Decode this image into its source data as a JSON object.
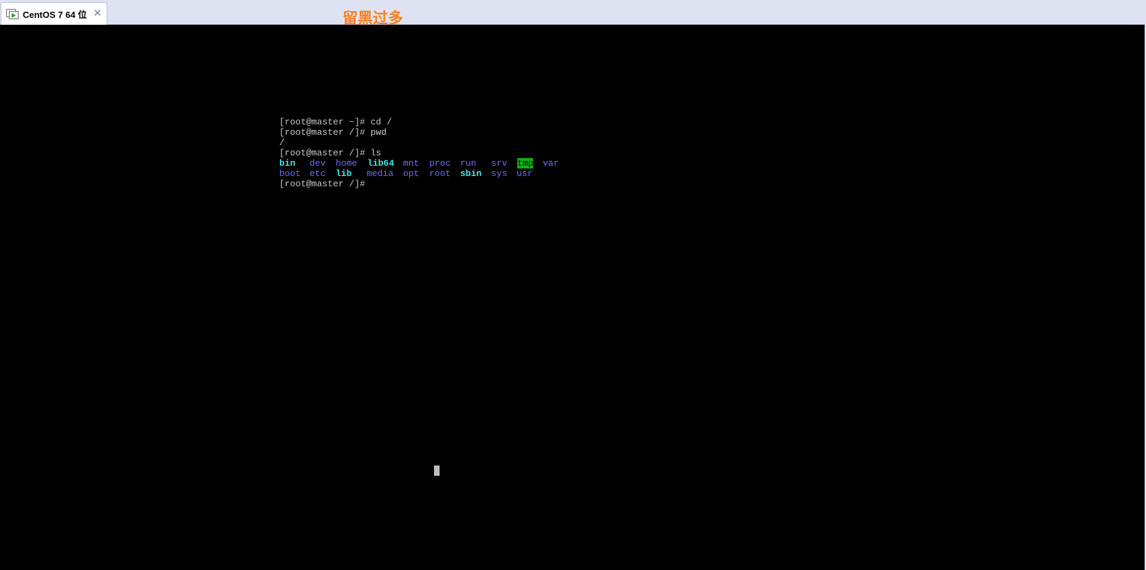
{
  "tab": {
    "title": "CentOS 7 64 位",
    "icon": "vm-screen-icon",
    "close_label": "✕"
  },
  "watermark": "留黑过多",
  "terminal": {
    "lines": [
      "[root@master ~]# cd /",
      "[root@master /]# pwd",
      "/",
      "[root@master /]# ls"
    ],
    "ls_row1": [
      "bin",
      "dev",
      "home",
      "lib64",
      "mnt",
      "proc",
      "run",
      "srv",
      "tmp",
      "var"
    ],
    "ls_row2": [
      "boot",
      "etc",
      "lib",
      "media",
      "opt",
      "root",
      "sbin",
      "sys",
      "usr"
    ],
    "final_prompt": "[root@master /]#"
  },
  "colors": {
    "directory": "#6d6dff",
    "symlink": "#43e6e6",
    "sticky_dir_bg": "#14b014",
    "text": "#c8c8c8",
    "background": "#000000",
    "watermark": "#ff7f1f"
  }
}
